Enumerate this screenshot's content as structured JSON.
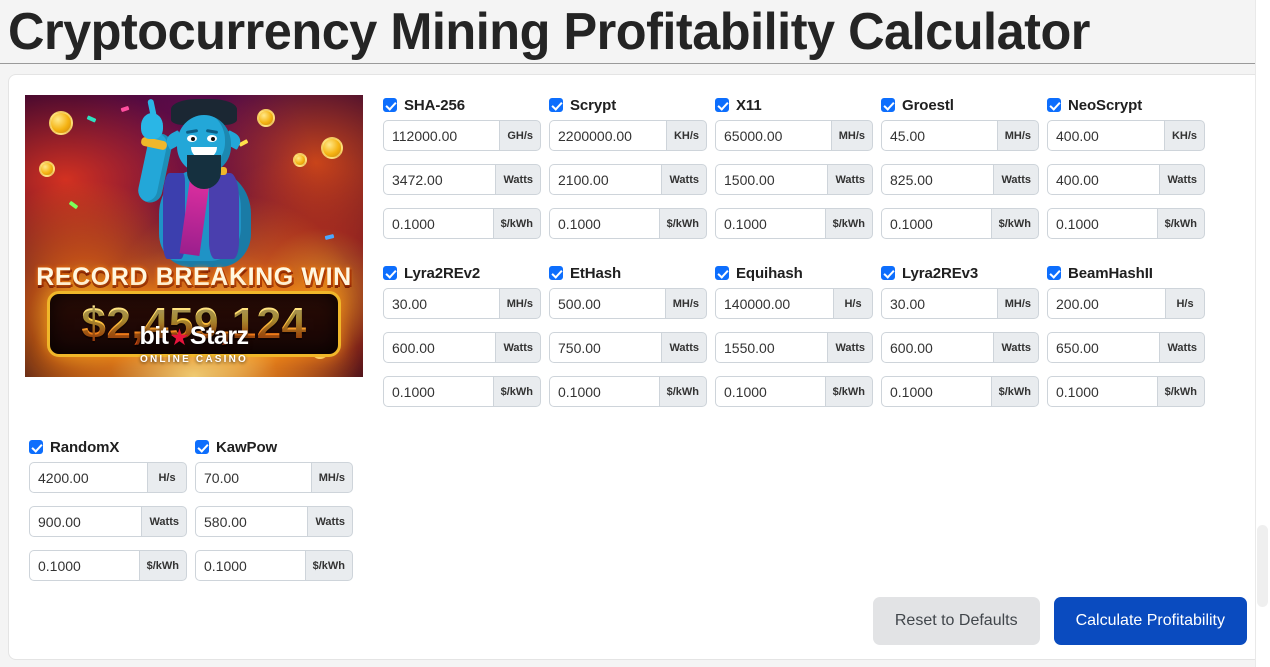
{
  "header": {
    "title": "Cryptocurrency Mining Profitability Calculator"
  },
  "ad": {
    "headline": "RECORD BREAKING WIN",
    "amount": "$2,459,124",
    "brand_part1": "bit",
    "brand_star": "★",
    "brand_part2": "Starz",
    "tagline": "ONLINE CASINO"
  },
  "algorithm_rows": [
    [
      {
        "name": "SHA-256",
        "enabled": true,
        "hashrate": "112000.00",
        "hashrate_unit": "GH/s",
        "power": "3472.00",
        "power_unit": "Watts",
        "cost": "0.1000",
        "cost_unit": "$/kWh"
      },
      {
        "name": "Scrypt",
        "enabled": true,
        "hashrate": "2200000.00",
        "hashrate_unit": "KH/s",
        "power": "2100.00",
        "power_unit": "Watts",
        "cost": "0.1000",
        "cost_unit": "$/kWh"
      },
      {
        "name": "X11",
        "enabled": true,
        "hashrate": "65000.00",
        "hashrate_unit": "MH/s",
        "power": "1500.00",
        "power_unit": "Watts",
        "cost": "0.1000",
        "cost_unit": "$/kWh"
      },
      {
        "name": "Groestl",
        "enabled": true,
        "hashrate": "45.00",
        "hashrate_unit": "MH/s",
        "power": "825.00",
        "power_unit": "Watts",
        "cost": "0.1000",
        "cost_unit": "$/kWh"
      },
      {
        "name": "NeoScrypt",
        "enabled": true,
        "hashrate": "400.00",
        "hashrate_unit": "KH/s",
        "power": "400.00",
        "power_unit": "Watts",
        "cost": "0.1000",
        "cost_unit": "$/kWh"
      }
    ],
    [
      {
        "name": "Lyra2REv2",
        "enabled": true,
        "hashrate": "30.00",
        "hashrate_unit": "MH/s",
        "power": "600.00",
        "power_unit": "Watts",
        "cost": "0.1000",
        "cost_unit": "$/kWh"
      },
      {
        "name": "EtHash",
        "enabled": true,
        "hashrate": "500.00",
        "hashrate_unit": "MH/s",
        "power": "750.00",
        "power_unit": "Watts",
        "cost": "0.1000",
        "cost_unit": "$/kWh"
      },
      {
        "name": "Equihash",
        "enabled": true,
        "hashrate": "140000.00",
        "hashrate_unit": "H/s",
        "power": "1550.00",
        "power_unit": "Watts",
        "cost": "0.1000",
        "cost_unit": "$/kWh"
      },
      {
        "name": "Lyra2REv3",
        "enabled": true,
        "hashrate": "30.00",
        "hashrate_unit": "MH/s",
        "power": "600.00",
        "power_unit": "Watts",
        "cost": "0.1000",
        "cost_unit": "$/kWh"
      },
      {
        "name": "BeamHashII",
        "enabled": true,
        "hashrate": "200.00",
        "hashrate_unit": "H/s",
        "power": "650.00",
        "power_unit": "Watts",
        "cost": "0.1000",
        "cost_unit": "$/kWh"
      }
    ]
  ],
  "algorithm_rows_extra": [
    [
      {
        "name": "RandomX",
        "enabled": true,
        "hashrate": "4200.00",
        "hashrate_unit": "H/s",
        "power": "900.00",
        "power_unit": "Watts",
        "cost": "0.1000",
        "cost_unit": "$/kWh"
      },
      {
        "name": "KawPow",
        "enabled": true,
        "hashrate": "70.00",
        "hashrate_unit": "MH/s",
        "power": "580.00",
        "power_unit": "Watts",
        "cost": "0.1000",
        "cost_unit": "$/kWh"
      }
    ]
  ],
  "buttons": {
    "reset_label": "Reset to Defaults",
    "calculate_label": "Calculate Profitability"
  },
  "colors": {
    "accent_blue": "#0a4bbf",
    "checkbox_blue": "#0d6efd",
    "reset_gray": "#e2e3e5",
    "page_background": "#f4f4f4",
    "card_background": "#ffffff",
    "addon_background": "#e9ecef"
  }
}
